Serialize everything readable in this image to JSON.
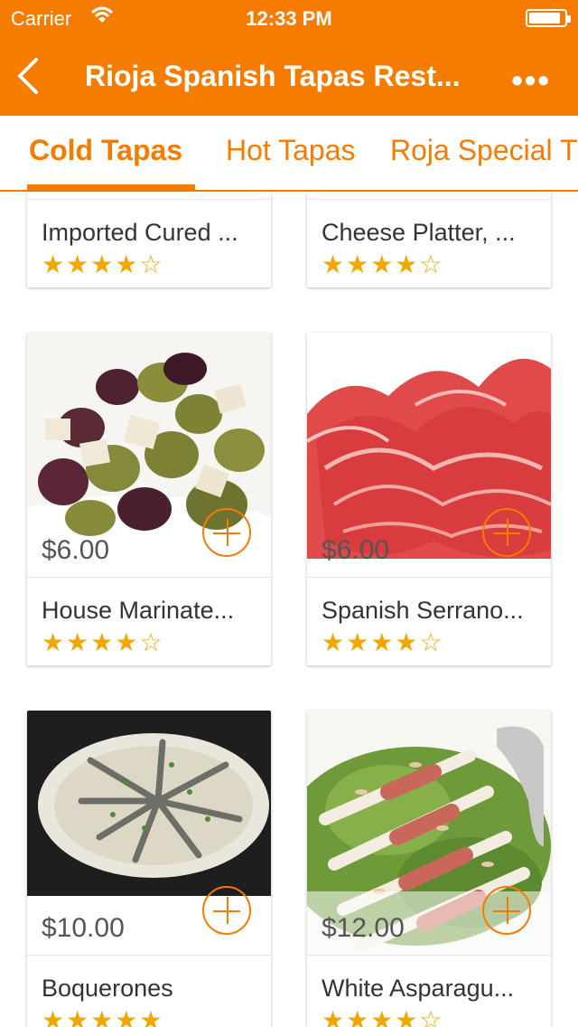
{
  "status_bar": {
    "carrier": "Carrier",
    "time": "12:33 PM",
    "battery_level": 0.9
  },
  "navbar": {
    "title": "Rioja Spanish Tapas Rest...",
    "more": "•••"
  },
  "tabs": [
    {
      "label": "Cold Tapas"
    },
    {
      "label": "Hot Tapas"
    },
    {
      "label": "Roja Special T"
    }
  ],
  "items": [
    {
      "name": "Imported Cured ...",
      "stars": "★★★★☆",
      "rating": 4
    },
    {
      "name": "Cheese Platter, ...",
      "stars": "★★★★☆",
      "rating": 4
    },
    {
      "name": "House Marinate...",
      "price": "$6.00",
      "stars": "★★★★☆",
      "rating": 4
    },
    {
      "name": "Spanish Serrano...",
      "price": "$6.00",
      "stars": "★★★★☆",
      "rating": 4
    },
    {
      "name": "Boquerones",
      "price": "$10.00",
      "stars": "★★★★★",
      "rating": 5
    },
    {
      "name": "White Asparagu...",
      "price": "$12.00",
      "stars": "★★★★☆",
      "rating": 4
    }
  ],
  "colors": {
    "accent": "#f57c00",
    "star": "#f0a800"
  }
}
